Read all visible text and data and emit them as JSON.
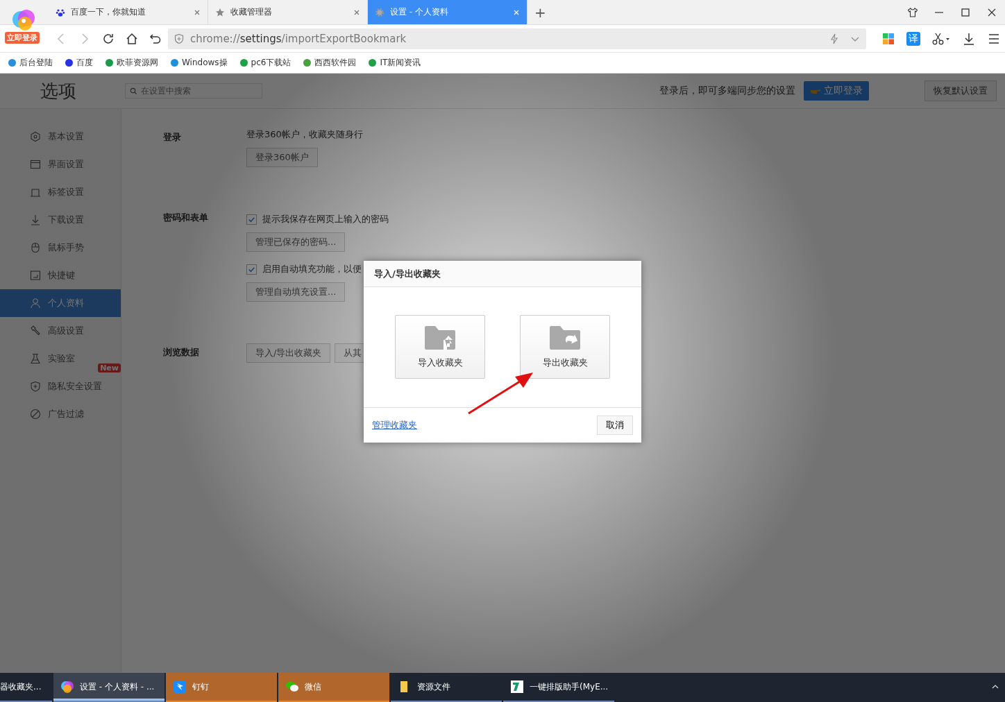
{
  "browser": {
    "login_badge": "立即登录",
    "tabs": [
      {
        "title": "百度一下，你就知道",
        "selected": false
      },
      {
        "title": "收藏管理器",
        "selected": false
      },
      {
        "title": "设置 - 个人资料",
        "selected": true
      }
    ],
    "translate_button": "译",
    "new_tab": "+",
    "address": {
      "scheme": "chrome://",
      "host": "settings",
      "path": "/importExportBookmark"
    },
    "bookmarks": [
      {
        "label": "后台登陆",
        "color": "#2a8fd8"
      },
      {
        "label": "百度",
        "color": "#2932e1"
      },
      {
        "label": "欧菲资源网",
        "color": "#1a9a4a"
      },
      {
        "label": "Windows操",
        "color": "#1e8fd8"
      },
      {
        "label": "pc6下载站",
        "color": "#21a04a"
      },
      {
        "label": "西西软件园",
        "color": "#48a23f"
      },
      {
        "label": "IT新闻资讯",
        "color": "#21a04a"
      }
    ]
  },
  "settings": {
    "title": "选项",
    "search": {
      "placeholder": "在设置中搜索"
    },
    "sync_text": "登录后，即可多端同步您的设置",
    "login_button": "立即登录",
    "restore_button": "恢复默认设置",
    "sidebar": [
      {
        "label": "基本设置",
        "selected": false
      },
      {
        "label": "界面设置",
        "selected": false
      },
      {
        "label": "标签设置",
        "selected": false
      },
      {
        "label": "下载设置",
        "selected": false
      },
      {
        "label": "鼠标手势",
        "selected": false
      },
      {
        "label": "快捷键",
        "selected": false
      },
      {
        "label": "个人资料",
        "selected": true
      },
      {
        "label": "高级设置",
        "selected": false
      },
      {
        "label": "实验室",
        "selected": false,
        "badge": "New"
      },
      {
        "label": "隐私安全设置",
        "selected": false
      },
      {
        "label": "广告过滤",
        "selected": false
      }
    ],
    "sections": [
      {
        "title": "登录",
        "items": [
          {
            "kind": "text",
            "text": "登录360帐户，收藏夹随身行"
          },
          {
            "kind": "button",
            "label": "登录360帐户"
          }
        ]
      },
      {
        "title": "密码和表单",
        "items": [
          {
            "kind": "checkbox",
            "label": "提示我保存在网页上输入的密码",
            "checked": true
          },
          {
            "kind": "button",
            "label": "管理已保存的密码..."
          },
          {
            "kind": "checkbox",
            "label": "启用自动填充功能，以便",
            "checked": true
          },
          {
            "kind": "button",
            "label": "管理自动填充设置..."
          }
        ]
      },
      {
        "title": "浏览数据",
        "items": [
          {
            "kind": "buttons",
            "labels": [
              "导入/导出收藏夹",
              "从其"
            ]
          }
        ]
      }
    ]
  },
  "dialog": {
    "title": "导入/导出收藏夹",
    "options": [
      {
        "label": "导入收藏夹",
        "kind": "import"
      },
      {
        "label": "导出收藏夹",
        "kind": "export"
      }
    ],
    "manage_link": "管理收藏夹",
    "cancel": "取消"
  },
  "taskbar": [
    {
      "label": "器收藏夹...",
      "flashing": false,
      "selected": false
    },
    {
      "label": "设置 - 个人资料 - ...",
      "flashing": false,
      "selected": true
    },
    {
      "label": "钉钉",
      "flashing": true,
      "selected": false
    },
    {
      "label": "微信",
      "flashing": true,
      "selected": false
    },
    {
      "label": "资源文件",
      "flashing": false,
      "selected": false
    },
    {
      "label": "一键排版助手(MyE...",
      "flashing": false,
      "selected": false
    }
  ]
}
